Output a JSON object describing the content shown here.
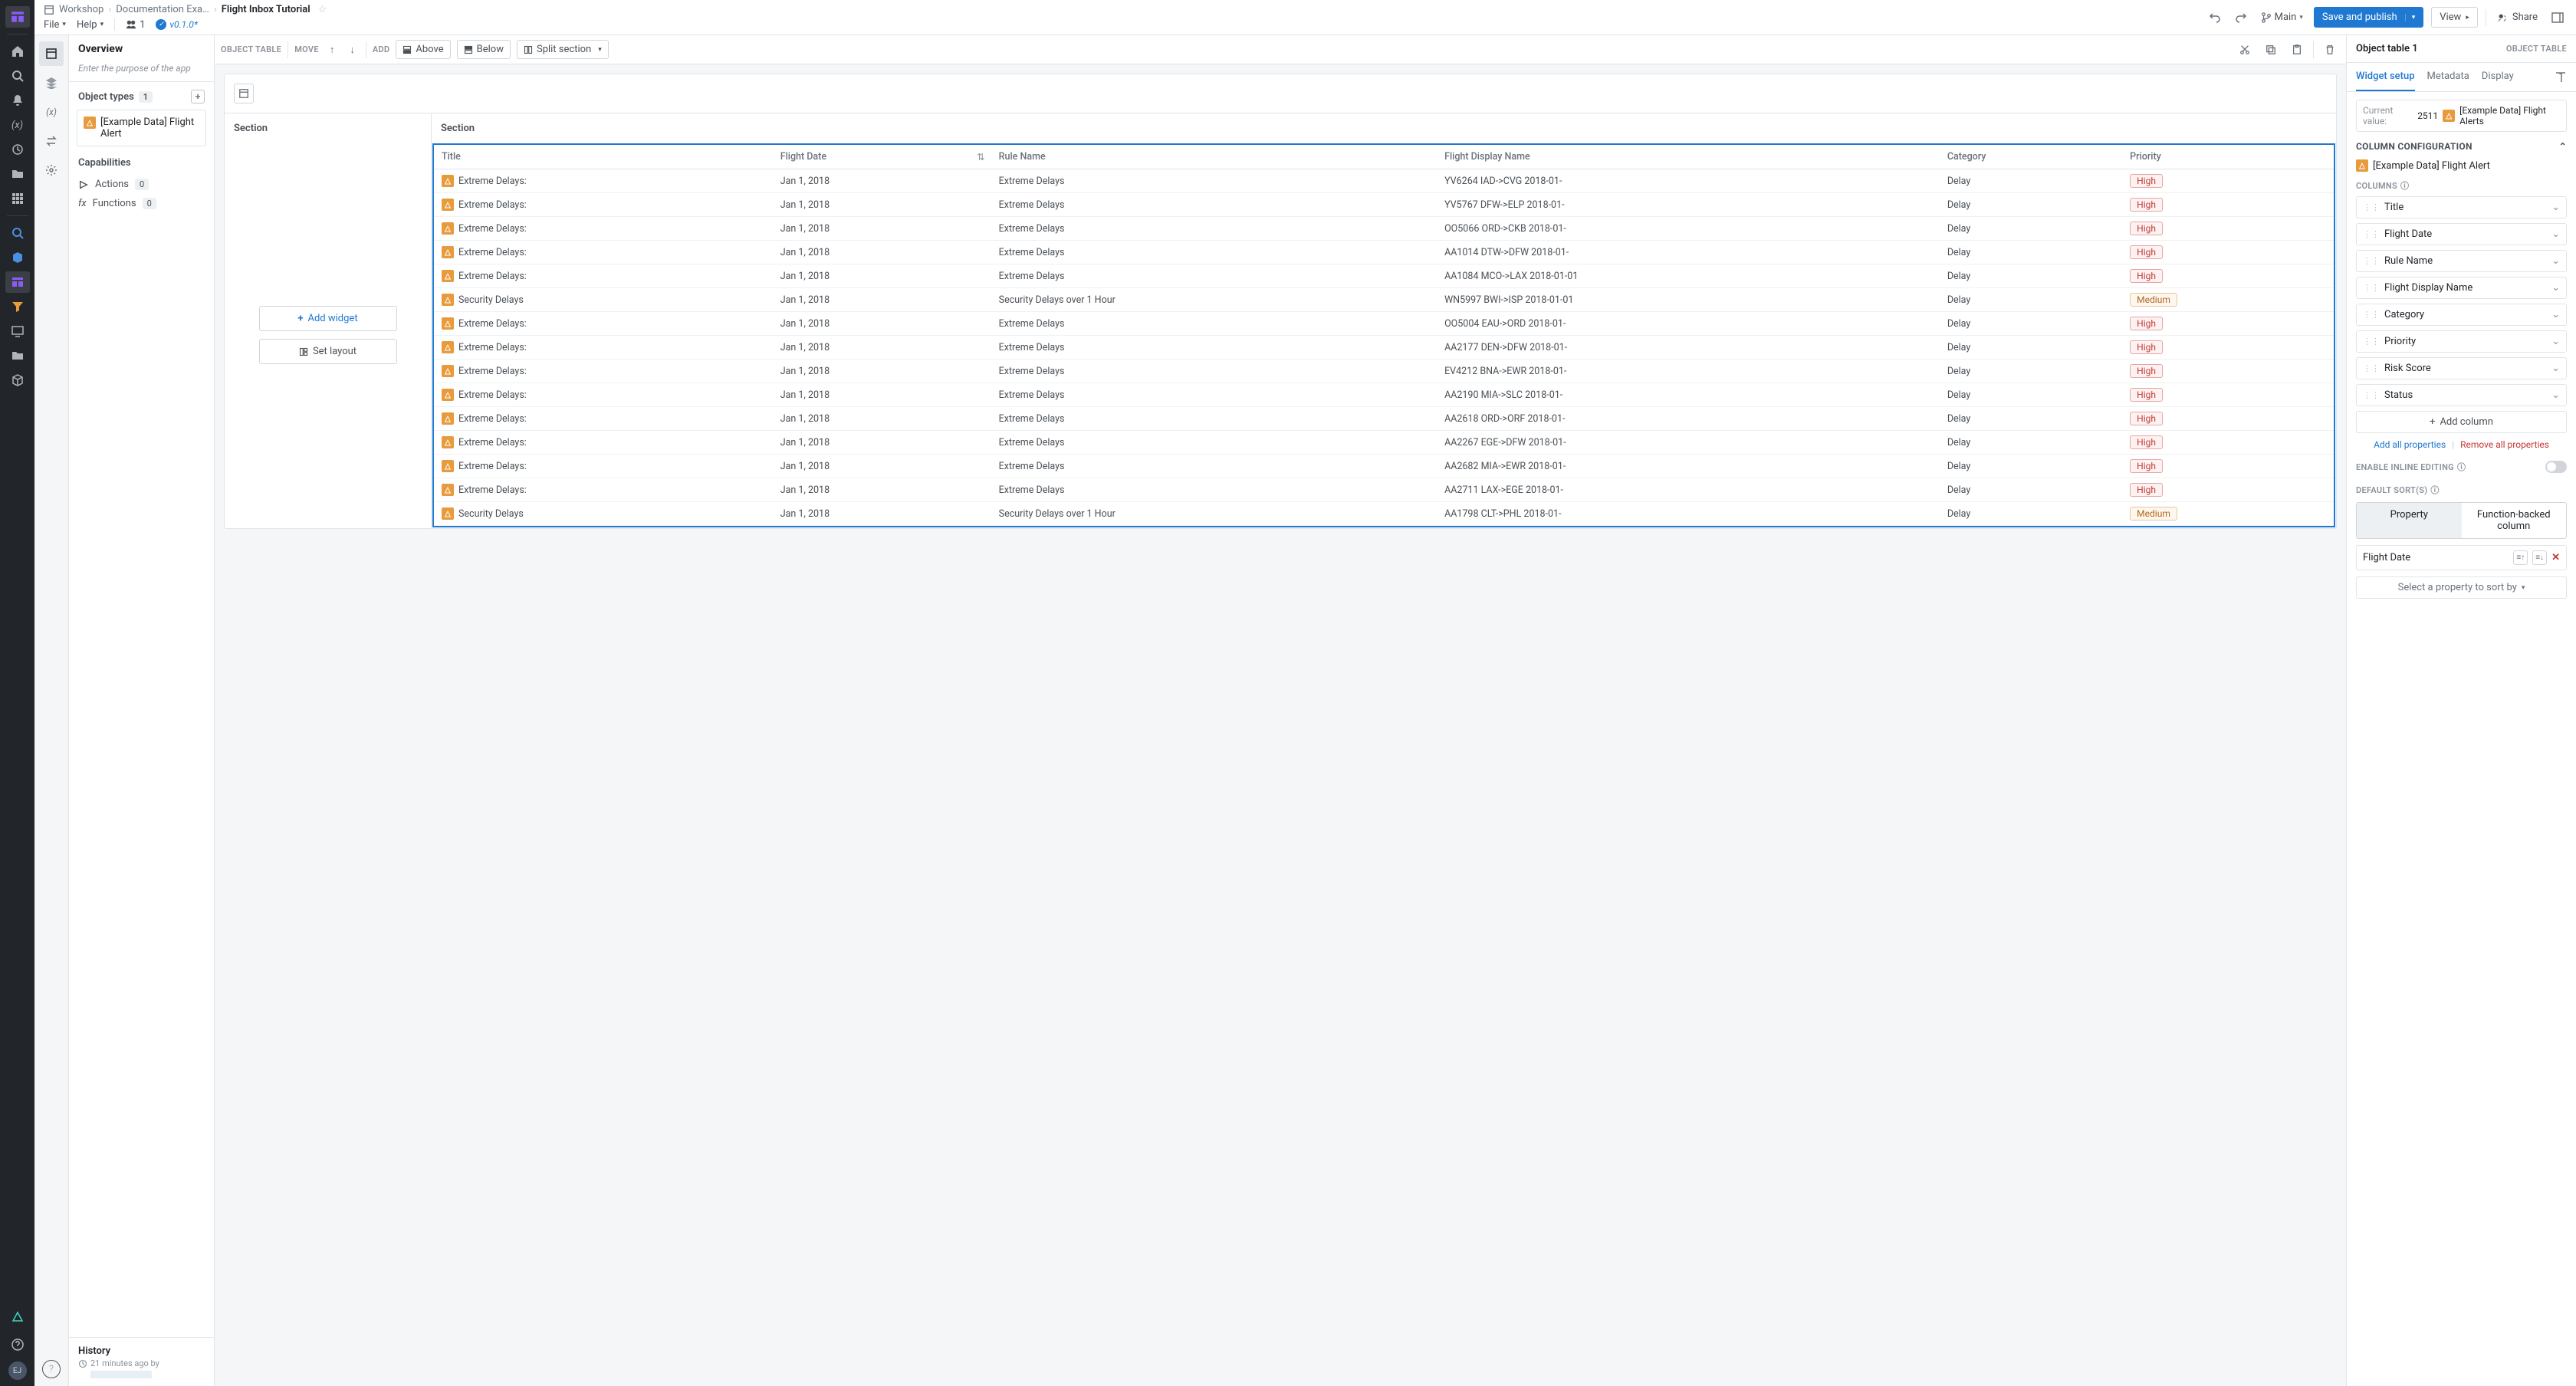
{
  "breadcrumb": {
    "workshop": "Workshop",
    "docs": "Documentation Exa…",
    "current": "Flight Inbox Tutorial"
  },
  "menu": {
    "file": "File",
    "help": "Help",
    "users_count": "1",
    "version": "v0.1.0*"
  },
  "topbar": {
    "main": "Main",
    "save": "Save and publish",
    "view": "View",
    "share": "Share"
  },
  "sidebar": {
    "overview": "Overview",
    "purpose_placeholder": "Enter the purpose of the app",
    "object_types": "Object types",
    "object_types_count": "1",
    "object_type_item": "[Example Data] Flight Alert",
    "capabilities": "Capabilities",
    "actions": "Actions",
    "actions_count": "0",
    "functions": "Functions",
    "functions_count": "0",
    "history": "History",
    "history_sub": "21 minutes ago by"
  },
  "toolbar": {
    "object_table": "OBJECT TABLE",
    "move": "MOVE",
    "add": "ADD",
    "above": "Above",
    "below": "Below",
    "split": "Split section"
  },
  "canvas": {
    "section_left": "Section",
    "section_right": "Section",
    "add_widget": "Add widget",
    "set_layout": "Set layout"
  },
  "table": {
    "headers": {
      "title": "Title",
      "flight_date": "Flight Date",
      "rule_name": "Rule Name",
      "flight_display": "Flight Display Name",
      "category": "Category",
      "priority": "Priority"
    },
    "rows": [
      {
        "title": "Extreme Delays:",
        "date": "Jan 1, 2018",
        "rule": "Extreme Delays",
        "display": "YV6264 IAD->CVG 2018-01-",
        "category": "Delay",
        "priority": "High"
      },
      {
        "title": "Extreme Delays:",
        "date": "Jan 1, 2018",
        "rule": "Extreme Delays",
        "display": "YV5767 DFW->ELP 2018-01-",
        "category": "Delay",
        "priority": "High"
      },
      {
        "title": "Extreme Delays:",
        "date": "Jan 1, 2018",
        "rule": "Extreme Delays",
        "display": "OO5066 ORD->CKB 2018-01-",
        "category": "Delay",
        "priority": "High"
      },
      {
        "title": "Extreme Delays:",
        "date": "Jan 1, 2018",
        "rule": "Extreme Delays",
        "display": "AA1014 DTW->DFW 2018-01-",
        "category": "Delay",
        "priority": "High"
      },
      {
        "title": "Extreme Delays:",
        "date": "Jan 1, 2018",
        "rule": "Extreme Delays",
        "display": "AA1084 MCO->LAX 2018-01-01",
        "category": "Delay",
        "priority": "High"
      },
      {
        "title": "Security Delays",
        "date": "Jan 1, 2018",
        "rule": "Security Delays over 1 Hour",
        "display": "WN5997 BWI->ISP 2018-01-01",
        "category": "Delay",
        "priority": "Medium"
      },
      {
        "title": "Extreme Delays:",
        "date": "Jan 1, 2018",
        "rule": "Extreme Delays",
        "display": "OO5004 EAU->ORD 2018-01-",
        "category": "Delay",
        "priority": "High"
      },
      {
        "title": "Extreme Delays:",
        "date": "Jan 1, 2018",
        "rule": "Extreme Delays",
        "display": "AA2177 DEN->DFW 2018-01-",
        "category": "Delay",
        "priority": "High"
      },
      {
        "title": "Extreme Delays:",
        "date": "Jan 1, 2018",
        "rule": "Extreme Delays",
        "display": "EV4212 BNA->EWR 2018-01-",
        "category": "Delay",
        "priority": "High"
      },
      {
        "title": "Extreme Delays:",
        "date": "Jan 1, 2018",
        "rule": "Extreme Delays",
        "display": "AA2190 MIA->SLC 2018-01-",
        "category": "Delay",
        "priority": "High"
      },
      {
        "title": "Extreme Delays:",
        "date": "Jan 1, 2018",
        "rule": "Extreme Delays",
        "display": "AA2618 ORD->ORF 2018-01-",
        "category": "Delay",
        "priority": "High"
      },
      {
        "title": "Extreme Delays:",
        "date": "Jan 1, 2018",
        "rule": "Extreme Delays",
        "display": "AA2267 EGE->DFW 2018-01-",
        "category": "Delay",
        "priority": "High"
      },
      {
        "title": "Extreme Delays:",
        "date": "Jan 1, 2018",
        "rule": "Extreme Delays",
        "display": "AA2682 MIA->EWR 2018-01-",
        "category": "Delay",
        "priority": "High"
      },
      {
        "title": "Extreme Delays:",
        "date": "Jan 1, 2018",
        "rule": "Extreme Delays",
        "display": "AA2711 LAX->EGE 2018-01-",
        "category": "Delay",
        "priority": "High"
      },
      {
        "title": "Security Delays",
        "date": "Jan 1, 2018",
        "rule": "Security Delays over 1 Hour",
        "display": "AA1798 CLT->PHL 2018-01-",
        "category": "Delay",
        "priority": "Medium"
      }
    ]
  },
  "right": {
    "title": "Object table 1",
    "type_label": "OBJECT TABLE",
    "tabs": {
      "setup": "Widget setup",
      "metadata": "Metadata",
      "display": "Display"
    },
    "current_value_label": "Current value:",
    "current_value_count": "2511",
    "current_value_name": "[Example Data] Flight Alerts",
    "column_config": "COLUMN CONFIGURATION",
    "obj_type": "[Example Data] Flight Alert",
    "columns_label": "COLUMNS",
    "columns": [
      "Title",
      "Flight Date",
      "Rule Name",
      "Flight Display Name",
      "Category",
      "Priority",
      "Risk Score",
      "Status"
    ],
    "add_column": "Add column",
    "add_all": "Add all properties",
    "remove_all": "Remove all properties",
    "inline_edit": "ENABLE INLINE EDITING",
    "default_sorts": "DEFAULT SORT(S)",
    "seg_property": "Property",
    "seg_function": "Function-backed column",
    "sort_item": "Flight Date",
    "select_property": "Select a property to sort by"
  }
}
